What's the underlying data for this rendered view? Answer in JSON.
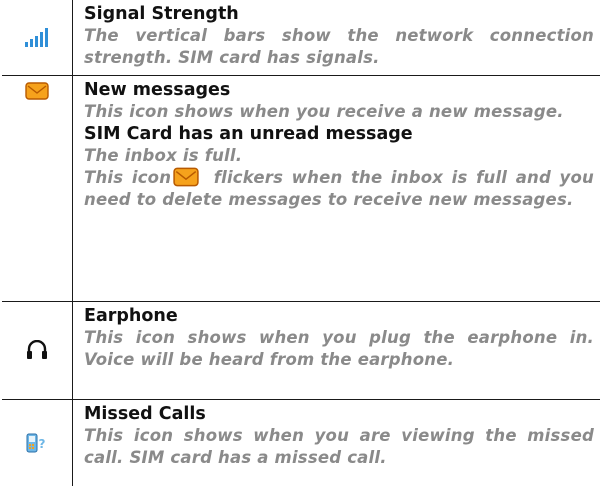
{
  "rows": [
    {
      "icon": "signal-strength-icon",
      "heading": "Signal Strength",
      "description": "The vertical bars show the network connection strength. SIM card has signals."
    },
    {
      "icon": "envelope-icon",
      "heading": "New messages",
      "description": "This icon shows when you receive a new message.",
      "sub_heading": "SIM Card has an unread message",
      "sub_line1": "The inbox is full.",
      "sub_line2_before": "This icon",
      "sub_line2_after": "flickers when the inbox is full and you need to delete messages to receive new messages."
    },
    {
      "icon": "earphone-icon",
      "heading": "Earphone",
      "description": "This icon shows when you plug the earphone in. Voice will be heard from the earphone."
    },
    {
      "icon": "missed-call-icon",
      "heading": "Missed Calls",
      "description": "This icon shows when you are viewing the missed call. SIM card has a missed call."
    }
  ],
  "colors": {
    "border": "#1a1a1a",
    "heading": "#111111",
    "description": "#8a8a8a",
    "signal_bars": "#2f8fd8",
    "envelope_fill": "#f6a21c",
    "envelope_stroke": "#b85a00",
    "earphone": "#111111",
    "phone_body": "#6fb7e6"
  }
}
